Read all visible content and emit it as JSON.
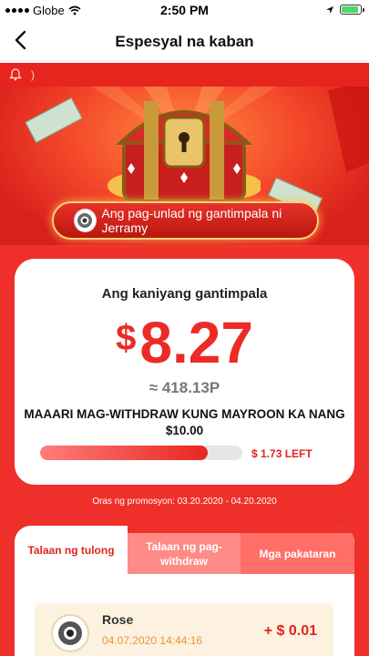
{
  "status_bar": {
    "carrier": "Globe",
    "time": "2:50 PM",
    "battery_color": "#4cd964"
  },
  "nav": {
    "back_icon": "chevron-left-icon",
    "title": "Espesyal na kaban"
  },
  "hero": {
    "notice_icon": "bell-icon",
    "notice_tail": ")",
    "cta_label": "Ang pag-unlad ng gantimpala ni Jerramy"
  },
  "reward": {
    "title": "Ang kaniyang gantimpala",
    "currency": "$",
    "amount": "8.27",
    "approx": "≈ 418.13P",
    "withdraw_note": "MAAARI MAG-WITHDRAW KUNG MAYROON KA NANG $10.00",
    "progress_fraction": 0.827,
    "left_label": "$ 1.73 LEFT"
  },
  "promo": "Oras ng promosyon: 03.20.2020 - 04.20.2020",
  "tabs": [
    {
      "label": "Talaan ng tulong",
      "active": true
    },
    {
      "label": "Talaan ng pag-withdraw",
      "active": false
    },
    {
      "label": "Mga pakataran",
      "active": false
    }
  ],
  "help_records": [
    {
      "name": "Rose",
      "time": "04.07.2020 14:44:16",
      "amount": "+ $ 0.01"
    }
  ],
  "colors": {
    "accent_red": "#ef2f2a",
    "amount_red": "#ec2a26"
  }
}
